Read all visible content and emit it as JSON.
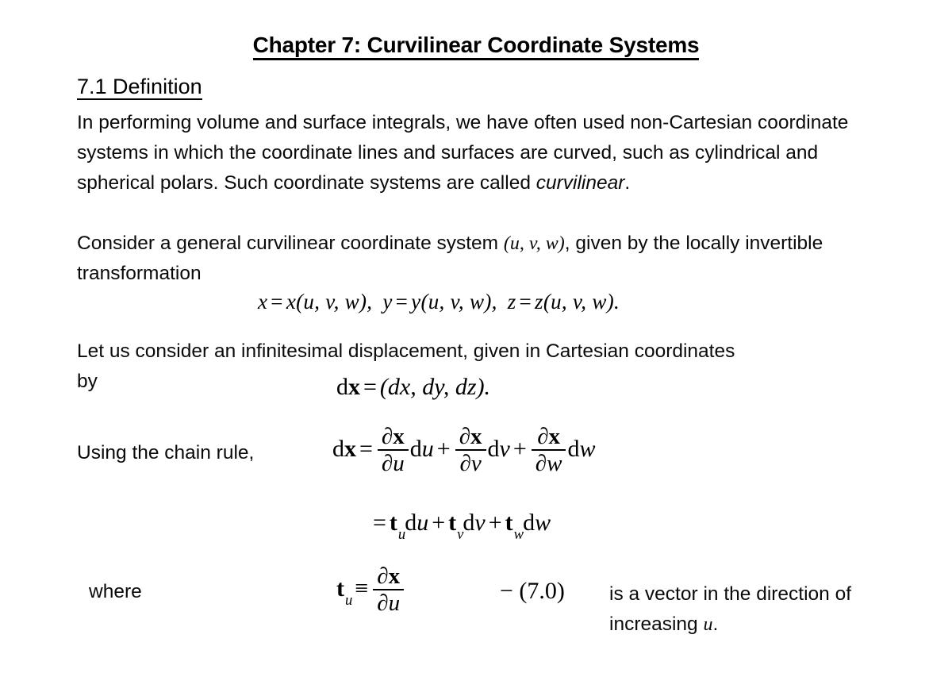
{
  "document": {
    "title": "Chapter 7: Curvilinear Coordinate Systems",
    "section_heading": "7.1 Definition",
    "background_color": "#ffffff",
    "text_color": "#000000"
  },
  "body": {
    "paragraph_1_part_1": "In performing volume and surface integrals, we have often used non-Cartesian coordinate systems in which the coordinate lines and surfaces are curved, such as cylindrical and spherical polars. Such coordinate systems are called ",
    "paragraph_1_emphasis": "curvilinear",
    "paragraph_1_part_2": ".",
    "paragraph_2_part_1": "Consider a general curvilinear coordinate system ",
    "paragraph_2_tuple": "(u, v, w)",
    "paragraph_2_part_2": ", given by the locally invertible transformation",
    "paragraph_3": "Let us consider an infinitesimal displacement, given in Cartesian coordinates",
    "label_by": "by",
    "label_chain_rule": "Using the chain rule,",
    "label_where": "where"
  },
  "equations": {
    "transformation": {
      "x_lhs": "x",
      "x_rhs": "x(u, v, w),",
      "y_lhs": "y",
      "y_rhs": "y(u, v, w),",
      "z_lhs": "z",
      "z_rhs": "z(u, v, w).",
      "equals": "=",
      "plain": "x = x(u, v, w),  y = y(u, v, w),  z = z(u, v, w)."
    },
    "displacement": {
      "lhs_d": "d",
      "lhs_vector": "x",
      "equals": "=",
      "rhs": "(dx, dy, dz).",
      "plain": "dx = (dx, dy, dz)."
    },
    "chain_rule": {
      "lhs_d": "d",
      "lhs_vector": "x",
      "equals": "=",
      "partial": "∂",
      "vector_x": "x",
      "term1_den": "u",
      "term1_diff_d": "d",
      "term1_diff_var": "u",
      "plus": "+",
      "term2_den": "v",
      "term2_diff_d": "d",
      "term2_diff_var": "v",
      "term3_den": "w",
      "term3_diff_d": "d",
      "term3_diff_var": "w",
      "plain": "dx = (∂x/∂u) du + (∂x/∂v) dv + (∂x/∂w) dw"
    },
    "tangent_sum": {
      "equals": "=",
      "t": "t",
      "sub_u": "u",
      "sub_v": "v",
      "sub_w": "w",
      "d": "d",
      "var_u": "u",
      "var_v": "v",
      "var_w": "w",
      "plus": "+",
      "plain": "= t_u du + t_v dv + t_w dw"
    },
    "tangent_definition": {
      "t": "t",
      "sub_u": "u",
      "identical_to": "≡",
      "partial": "∂",
      "vector_x": "x",
      "den_var": "u",
      "plain": "t_u ≡ ∂x/∂u"
    },
    "equation_number": "− (7.0)"
  },
  "side_note": {
    "line_1": "is a vector in the direction",
    "line_2_part_1": "of increasing ",
    "line_2_variable": "u",
    "line_2_part_2": "."
  }
}
